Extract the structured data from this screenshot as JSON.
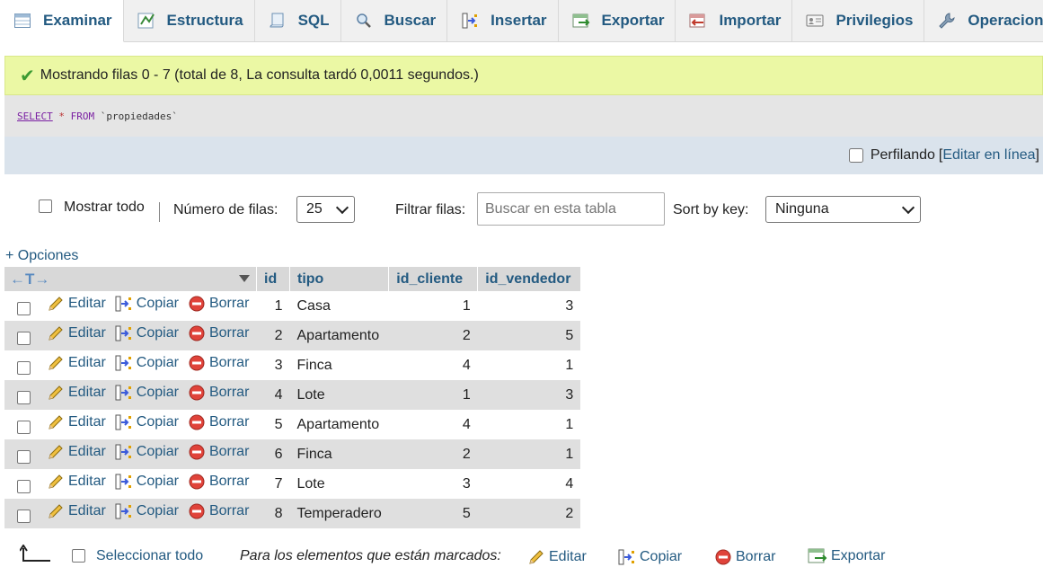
{
  "tabs": [
    {
      "label": "Examinar",
      "icon": "browse-icon",
      "active": true
    },
    {
      "label": "Estructura",
      "icon": "structure-icon"
    },
    {
      "label": "SQL",
      "icon": "sql-icon"
    },
    {
      "label": "Buscar",
      "icon": "search-icon"
    },
    {
      "label": "Insertar",
      "icon": "insert-icon"
    },
    {
      "label": "Exportar",
      "icon": "export-icon"
    },
    {
      "label": "Importar",
      "icon": "import-icon"
    },
    {
      "label": "Privilegios",
      "icon": "privileges-icon"
    },
    {
      "label": "Operaciones",
      "icon": "operations-icon"
    }
  ],
  "message": "Mostrando filas 0 - 7 (total de 8, La consulta tardó 0,0011 segundos.)",
  "sql": {
    "select": "SELECT",
    "star": "*",
    "from": "FROM",
    "table": "`propiedades`"
  },
  "profiling": {
    "label": "Perfilando",
    "bracket_open": "[",
    "edit_link": "Editar en línea",
    "bracket_close": "]"
  },
  "nav": {
    "show_all": "Mostrar todo",
    "rows_label": "Número de filas:",
    "rows_value": "25",
    "filter_label": "Filtrar filas:",
    "filter_placeholder": "Buscar en esta tabla",
    "sort_label": "Sort by key:",
    "sort_value": "Ninguna"
  },
  "options_link": "+ Opciones",
  "table": {
    "columns": [
      "id",
      "tipo",
      "id_cliente",
      "id_vendedor"
    ],
    "actions": {
      "edit": "Editar",
      "copy": "Copiar",
      "delete": "Borrar"
    },
    "rows": [
      {
        "id": "1",
        "tipo": "Casa",
        "id_cliente": "1",
        "id_vendedor": "3"
      },
      {
        "id": "2",
        "tipo": "Apartamento",
        "id_cliente": "2",
        "id_vendedor": "5"
      },
      {
        "id": "3",
        "tipo": "Finca",
        "id_cliente": "4",
        "id_vendedor": "1"
      },
      {
        "id": "4",
        "tipo": "Lote",
        "id_cliente": "1",
        "id_vendedor": "3"
      },
      {
        "id": "5",
        "tipo": "Apartamento",
        "id_cliente": "4",
        "id_vendedor": "1"
      },
      {
        "id": "6",
        "tipo": "Finca",
        "id_cliente": "2",
        "id_vendedor": "1"
      },
      {
        "id": "7",
        "tipo": "Lote",
        "id_cliente": "3",
        "id_vendedor": "4"
      },
      {
        "id": "8",
        "tipo": "Temperadero",
        "id_cliente": "5",
        "id_vendedor": "2"
      }
    ]
  },
  "footer": {
    "select_all": "Seleccionar todo",
    "marked_label": "Para los elementos que están marcados:",
    "edit": "Editar",
    "copy": "Copiar",
    "delete": "Borrar",
    "export": "Exportar"
  },
  "colors": {
    "link": "#235a81",
    "success_bg": "#ebf8a4",
    "header_bg": "#d8d8d8",
    "even_row": "#dfdfdf"
  }
}
